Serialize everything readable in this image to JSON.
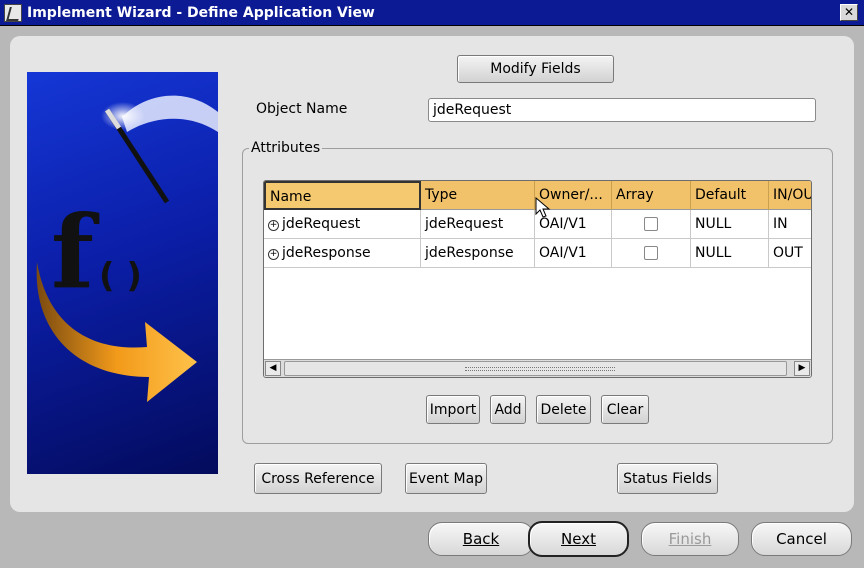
{
  "window": {
    "title": "Implement Wizard - Define Application View",
    "close_glyph": "✕"
  },
  "form": {
    "modify_fields_label": "Modify Fields",
    "object_name_label": "Object Name",
    "object_name_value": "jdeRequest",
    "attributes_label": "Attributes"
  },
  "table": {
    "columns": [
      "Name",
      "Type",
      "Owner/...",
      "Array",
      "Default",
      "IN/OU"
    ],
    "rows": [
      {
        "name": "jdeRequest",
        "type": "jdeRequest",
        "owner": "OAI/V1",
        "array": false,
        "default": "NULL",
        "inout": "IN"
      },
      {
        "name": "jdeResponse",
        "type": "jdeResponse",
        "owner": "OAI/V1",
        "array": false,
        "default": "NULL",
        "inout": "OUT"
      }
    ],
    "expander_glyph": "+"
  },
  "table_actions": {
    "import": "Import",
    "add": "Add",
    "delete": "Delete",
    "clear": "Clear"
  },
  "links": {
    "cross_reference": "Cross Reference",
    "event_map": "Event Map",
    "status_fields": "Status Fields"
  },
  "nav": {
    "back": "Back",
    "next": "Next",
    "finish": "Finish",
    "cancel": "Cancel"
  },
  "graphic": {
    "function_glyph": "f",
    "parens_glyph": "( )"
  },
  "colors": {
    "titlebar": "#0c1a93",
    "header": "#f2c26a",
    "graphic_blue": "#1537d6",
    "arrow_orange": "#f29a1a"
  }
}
